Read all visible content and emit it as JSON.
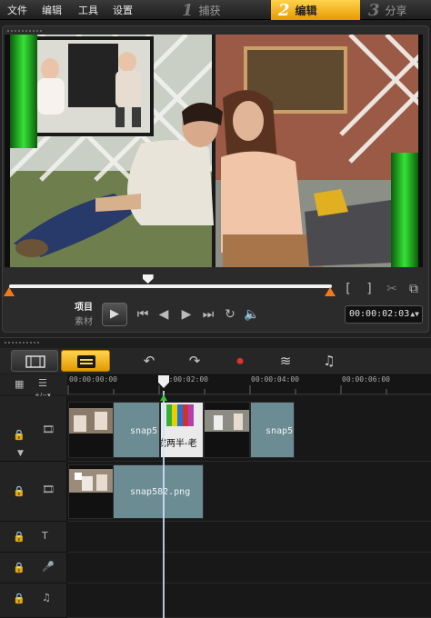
{
  "menu": {
    "file": "文件",
    "edit": "编辑",
    "tools": "工具",
    "settings": "设置"
  },
  "steps": [
    {
      "num": "1",
      "label": "捕获"
    },
    {
      "num": "2",
      "label": "编辑"
    },
    {
      "num": "3",
      "label": "分享"
    }
  ],
  "preview": {
    "mode_project": "项目",
    "mode_clip": "素材",
    "mark_in": "[",
    "mark_out": "]",
    "timecode": "00:00:02:03",
    "playhead_fraction": 0.43
  },
  "timeline": {
    "ruler": [
      "00:00:00:00",
      "00:00:02:00",
      "00:00:04:00",
      "00:00:06:00"
    ],
    "clip_labels": {
      "video_track_1": "snap5",
      "title_overlay": "成两半-老",
      "video_track_3": "snap5",
      "overlay_clip": "snap582.png"
    }
  },
  "colors": {
    "accent": "#f2a800",
    "trim_marker": "#f07a1a",
    "clip_teal": "#6c8c94"
  }
}
